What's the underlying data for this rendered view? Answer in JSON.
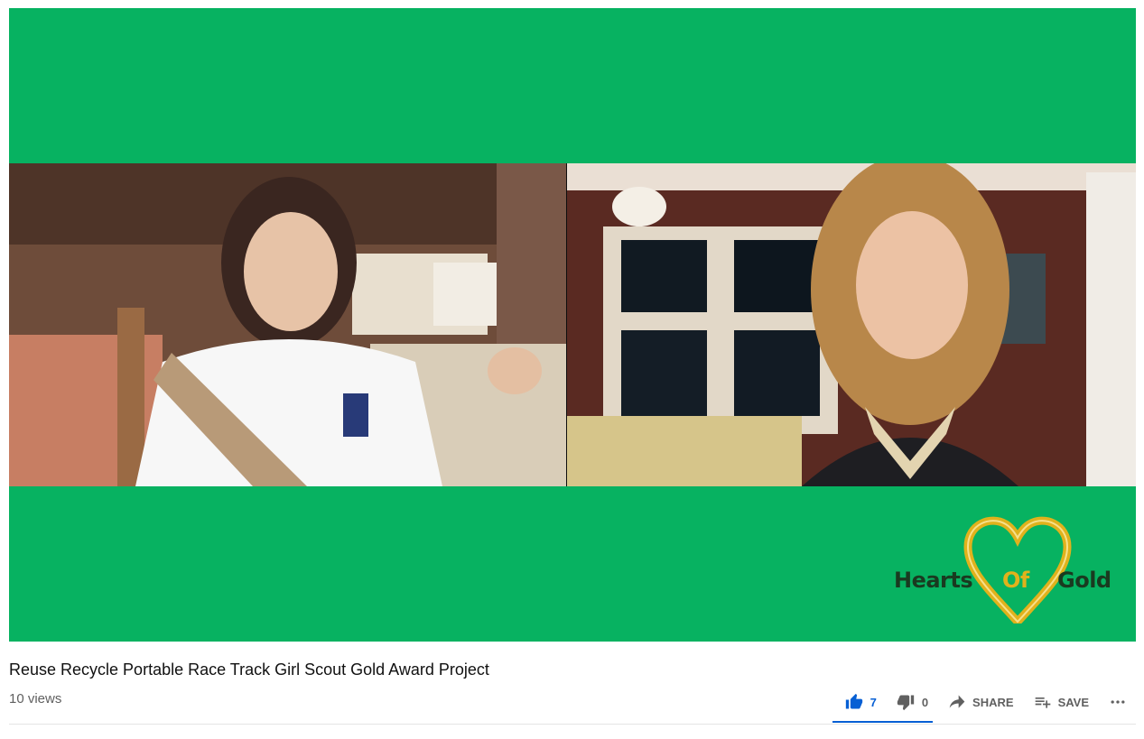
{
  "video": {
    "title": "Reuse Recycle Portable Race Track Girl Scout Gold Award Project",
    "views": "10 views",
    "background_color": "#07b261"
  },
  "logo": {
    "text_left": "Hearts",
    "text_middle": "Of",
    "text_right": "Gold",
    "heart_color": "#e0b21c"
  },
  "actions": {
    "like_count": "7",
    "dislike_count": "0",
    "share_label": "SHARE",
    "save_label": "SAVE",
    "accent_color": "#065fd4"
  }
}
